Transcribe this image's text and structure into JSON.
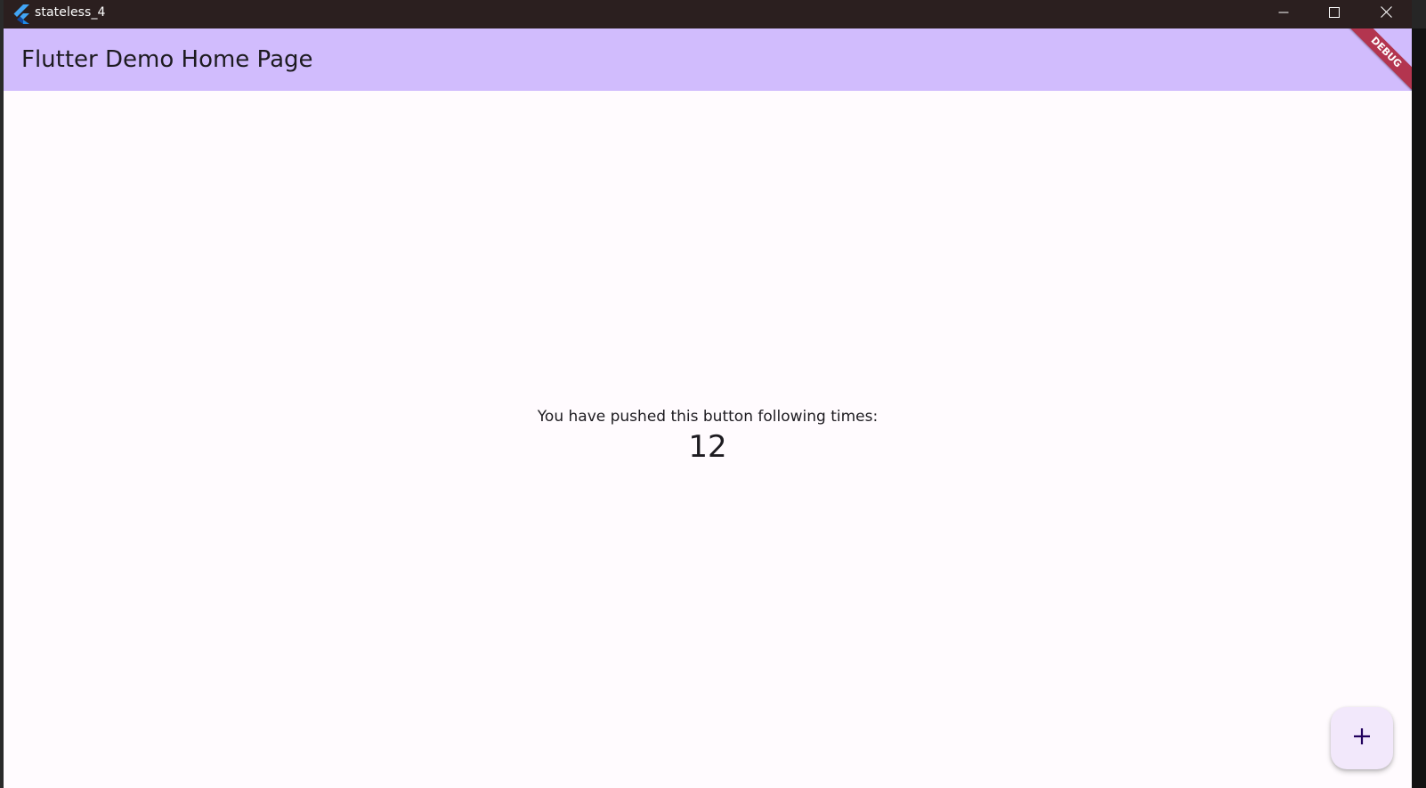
{
  "window": {
    "title": "stateless_4"
  },
  "appbar": {
    "title": "Flutter Demo Home Page"
  },
  "debug_banner": {
    "label": "DEBUG"
  },
  "counter": {
    "label": "You have pushed this button following times:",
    "value": "12"
  },
  "fab": {
    "icon": "plus-icon"
  },
  "colors": {
    "titlebar": "#2b1f1f",
    "appbar": "#d1bcfd",
    "background": "#fffbfe",
    "fab": "#f2e8fb",
    "debug_ribbon": "#b3354f",
    "text": "#1d1b20"
  }
}
